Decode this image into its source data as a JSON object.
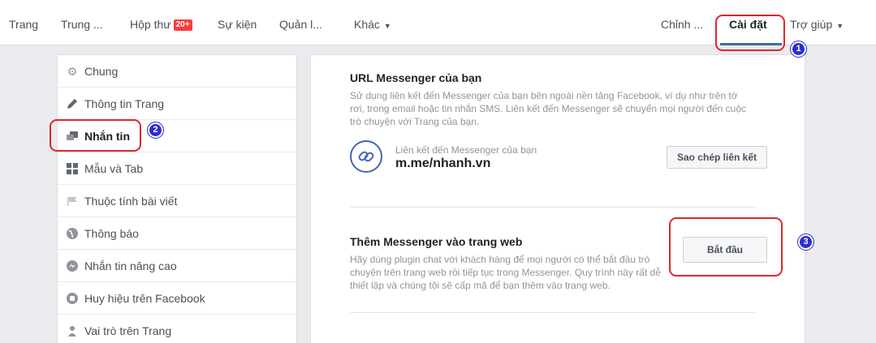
{
  "topnav": {
    "items": [
      {
        "label": "Trang"
      },
      {
        "label": "Trung ..."
      },
      {
        "label": "Hộp thư",
        "badge": "20+"
      },
      {
        "label": "Sự kiện"
      },
      {
        "label": "Quản l..."
      },
      {
        "label": "Khác"
      },
      {
        "label": "Chỉnh ..."
      },
      {
        "label": "Cài đặt"
      },
      {
        "label": "Trợ giúp"
      }
    ]
  },
  "sidebar": {
    "items": [
      {
        "label": "Chung",
        "icon": "gear-icon"
      },
      {
        "label": "Thông tin Trang",
        "icon": "pencil-icon"
      },
      {
        "label": "Nhắn tin",
        "icon": "chat-icon"
      },
      {
        "label": "Mẫu và Tab",
        "icon": "grid-icon"
      },
      {
        "label": "Thuộc tính bài viết",
        "icon": "flag-icon"
      },
      {
        "label": "Thông báo",
        "icon": "globe-icon"
      },
      {
        "label": "Nhắn tin nâng cao",
        "icon": "messenger-icon"
      },
      {
        "label": "Huy hiệu trên Facebook",
        "icon": "badge-icon"
      },
      {
        "label": "Vai trò trên Trang",
        "icon": "person-icon"
      }
    ]
  },
  "main": {
    "url_section": {
      "title": "URL Messenger của bạn",
      "description": "Sử dụng liên kết đến Messenger của bạn bên ngoài nền tảng Facebook, ví dụ như trên tờ rơi, trong email hoặc tin nhắn SMS. Liên kết đến Messenger sẽ chuyển mọi người đến cuộc trò chuyện với Trang của bạn.",
      "link_caption": "Liên kết đến Messenger của bạn",
      "link_url": "m.me/nhanh.vn",
      "copy_button": "Sao chép liên kết"
    },
    "web_section": {
      "title": "Thêm Messenger vào trang web",
      "description": "Hãy dùng plugin chat với khách hàng để mọi người có thể bắt đầu trò chuyện trên trang web rồi tiếp tục trong Messenger. Quy trình này rất dễ thiết lập và chúng tôi sẽ cấp mã để bạn thêm vào trang web.",
      "start_button": "Bắt đầu"
    }
  },
  "annotations": [
    "1",
    "2",
    "3"
  ],
  "colors": {
    "accent": "#4267b2",
    "annotation_red": "#e0262b",
    "annotation_blue": "#2b2ecf",
    "badge": "#fa3e3e"
  }
}
